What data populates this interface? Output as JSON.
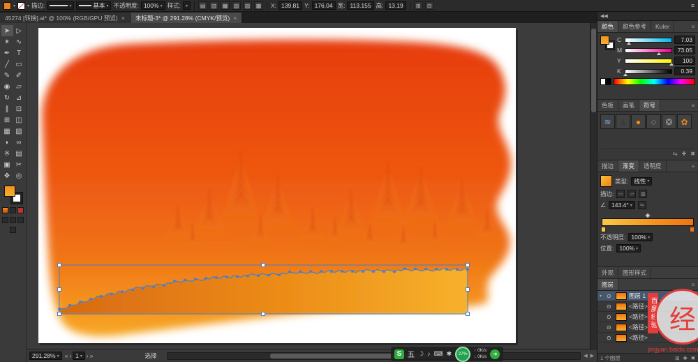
{
  "control_bar": {
    "stroke_label": "描边:",
    "brush_style": "基本",
    "opacity_label": "不透明度:",
    "opacity_value": "100%",
    "style_label": "样式:",
    "x_label": "X:",
    "x_value": "139.81",
    "y_label": "Y:",
    "y_value": "176.04",
    "w_label": "宽:",
    "w_value": "113.155",
    "h_label": "高:",
    "h_value": "13.19",
    "menu_icon": "≡"
  },
  "tabs": [
    {
      "title": "45274 [转换].ai* @ 100% (RGB/GPU 预览)",
      "close": "×",
      "active": false
    },
    {
      "title": "未标题-3* @ 291.28% (CMYK/预览)",
      "close": "×",
      "active": true
    }
  ],
  "toolbar": {
    "tools": [
      {
        "name": "selection-tool",
        "glyph": "➤"
      },
      {
        "name": "direct-selection-tool",
        "glyph": "▷"
      },
      {
        "name": "magic-wand-tool",
        "glyph": "✶"
      },
      {
        "name": "lasso-tool",
        "glyph": "∿"
      },
      {
        "name": "pen-tool",
        "glyph": "✒"
      },
      {
        "name": "type-tool",
        "glyph": "T"
      },
      {
        "name": "line-segment-tool",
        "glyph": "╱"
      },
      {
        "name": "rectangle-tool",
        "glyph": "▭"
      },
      {
        "name": "paintbrush-tool",
        "glyph": "✎"
      },
      {
        "name": "pencil-tool",
        "glyph": "✐"
      },
      {
        "name": "blob-brush-tool",
        "glyph": "◉"
      },
      {
        "name": "eraser-tool",
        "glyph": "▱"
      },
      {
        "name": "rotate-tool",
        "glyph": "↻"
      },
      {
        "name": "scale-tool",
        "glyph": "⊿"
      },
      {
        "name": "width-tool",
        "glyph": "∥"
      },
      {
        "name": "free-transform-tool",
        "glyph": "⊡"
      },
      {
        "name": "shape-builder-tool",
        "glyph": "⊞"
      },
      {
        "name": "perspective-grid-tool",
        "glyph": "◫"
      },
      {
        "name": "mesh-tool",
        "glyph": "▦"
      },
      {
        "name": "gradient-tool",
        "glyph": "▧"
      },
      {
        "name": "eyedropper-tool",
        "glyph": "◗"
      },
      {
        "name": "blend-tool",
        "glyph": "∞"
      },
      {
        "name": "symbol-sprayer-tool",
        "glyph": "※"
      },
      {
        "name": "column-graph-tool",
        "glyph": "▤"
      },
      {
        "name": "artboard-tool",
        "glyph": "▣"
      },
      {
        "name": "slice-tool",
        "glyph": "✂"
      },
      {
        "name": "hand-tool",
        "glyph": "❖"
      },
      {
        "name": "zoom-tool",
        "glyph": "◎"
      }
    ]
  },
  "panels": {
    "dock_collapse": "◀◀",
    "color": {
      "tabs": [
        "颜色",
        "颜色参考",
        "Kuler"
      ],
      "menu_icon": "≡",
      "channels": [
        {
          "label": "C",
          "value": "7.03",
          "pct": 7,
          "color": "#00b7ef"
        },
        {
          "label": "M",
          "value": "73.05",
          "pct": 73,
          "color": "#ec008c"
        },
        {
          "label": "Y",
          "value": "100",
          "pct": 100,
          "color": "#fff200"
        },
        {
          "label": "K",
          "value": "0.39",
          "pct": 0.4,
          "color": "#000000"
        }
      ]
    },
    "swatches": {
      "tabs": [
        "色板",
        "画笔",
        "符号"
      ],
      "symbols": [
        {
          "name": "symbol-grid",
          "glyph": "≋",
          "color": "#6f9fd8"
        },
        {
          "name": "symbol-figure",
          "glyph": "♟",
          "color": "#3a3a3a"
        },
        {
          "name": "symbol-orange-dot",
          "glyph": "●",
          "color": "#f0881c"
        },
        {
          "name": "symbol-ring",
          "glyph": "◌",
          "color": "#cccccc"
        },
        {
          "name": "symbol-gear",
          "glyph": "❂",
          "color": "#9a9a9a"
        },
        {
          "name": "symbol-flower",
          "glyph": "✿",
          "color": "#f0881c"
        }
      ]
    },
    "gradient": {
      "tabs": [
        "描边",
        "渐变",
        "透明度"
      ],
      "type_label": "类型:",
      "type_value": "线性",
      "stroke_label": "描边:",
      "angle_icon": "∠",
      "angle_value": "143.4°",
      "opacity_label": "不透明度:",
      "opacity_value": "100%",
      "location_label": "位置:",
      "location_value": "100%"
    },
    "appearance": {
      "tabs": [
        "外观",
        "图形样式"
      ]
    },
    "layers": {
      "header": "图层",
      "rows": [
        {
          "name": "图层 1",
          "selected": true,
          "expander": "▾"
        },
        {
          "name": "<路径>",
          "selected": false,
          "expander": ""
        },
        {
          "name": "<路径>",
          "selected": false,
          "expander": ""
        },
        {
          "name": "<路径>",
          "selected": false,
          "expander": ""
        },
        {
          "name": "<路径>",
          "selected": false,
          "expander": ""
        }
      ],
      "footer": "1 个图层",
      "footer_icons": [
        "⊞",
        "✚",
        "✖"
      ]
    }
  },
  "status_bar": {
    "zoom": "291.28%",
    "nav_first": "«",
    "nav_prev": "‹",
    "artboard": "1",
    "nav_next": "›",
    "nav_last": "»",
    "tool_hint": "选择"
  },
  "overlay": {
    "logo": "S",
    "char": "五",
    "icons": [
      {
        "name": "moon-icon",
        "glyph": "☽"
      },
      {
        "name": "music-icon",
        "glyph": "♪"
      },
      {
        "name": "keyboard-icon",
        "glyph": "⌨"
      },
      {
        "name": "settings-icon",
        "glyph": "✱"
      }
    ],
    "progress": "27%",
    "up": "↑ 0K/s",
    "down": "↓ 0K/s",
    "go": "➜"
  },
  "watermark": {
    "badge": "经",
    "ribbon": "百度经验",
    "url": "jingyan.baidu.com"
  },
  "colors": {
    "selection": "#3f7fd6",
    "blob_top": "#e63c0e",
    "blob_mid": "#f07316",
    "blob_bottom": "#f7a823",
    "band_left": "#d96a10",
    "band_mid": "#ec8c18",
    "band_right": "#f7b12b",
    "mound_top": "#dd3b0f",
    "mound_mid": "#ee7a16"
  }
}
